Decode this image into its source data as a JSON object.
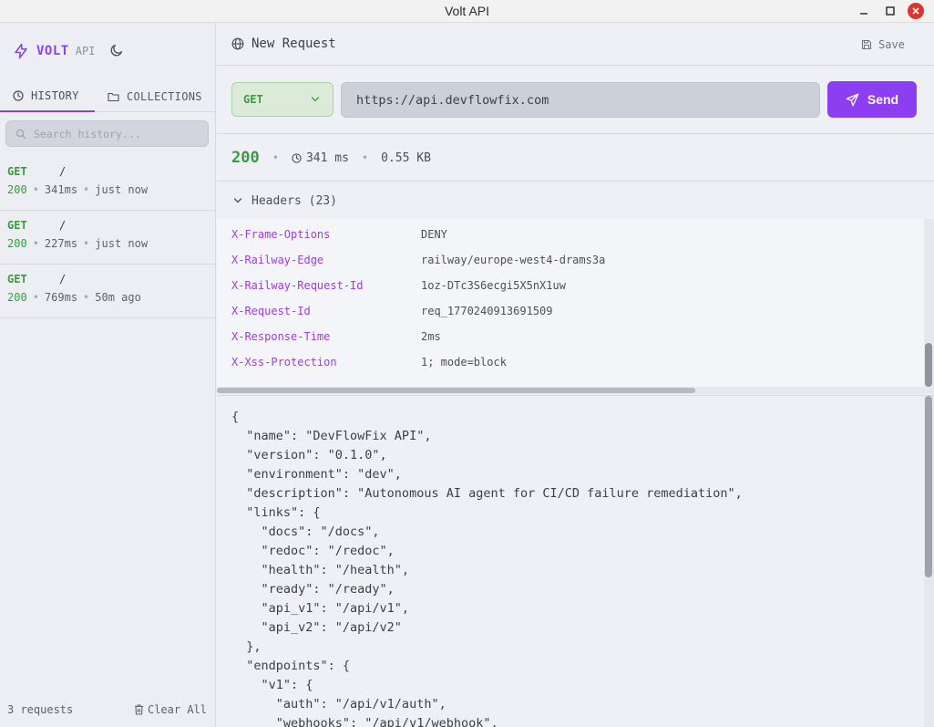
{
  "window": {
    "title": "Volt API"
  },
  "brand": {
    "name": "VOLT",
    "suffix": "API"
  },
  "sidebar": {
    "tabs": [
      {
        "label": "HISTORY",
        "icon": "clock-icon",
        "active": true
      },
      {
        "label": "COLLECTIONS",
        "icon": "folder-icon",
        "active": false
      }
    ],
    "search_placeholder": "Search history...",
    "history": [
      {
        "method": "GET",
        "path": "/",
        "status": "200",
        "time": "341ms",
        "age": "just now"
      },
      {
        "method": "GET",
        "path": "/",
        "status": "200",
        "time": "227ms",
        "age": "just now"
      },
      {
        "method": "GET",
        "path": "/",
        "status": "200",
        "time": "769ms",
        "age": "50m ago"
      }
    ],
    "footer_count": "3 requests",
    "clear_label": "Clear All"
  },
  "request": {
    "title": "New Request",
    "save_label": "Save",
    "method": "GET",
    "url": "https://api.devflowfix.com",
    "send_label": "Send"
  },
  "response": {
    "status": "200",
    "time": "341 ms",
    "size": "0.55 KB",
    "headers_label": "Headers (23)",
    "headers": [
      {
        "key": "X-Frame-Options",
        "value": "DENY"
      },
      {
        "key": "X-Railway-Edge",
        "value": "railway/europe-west4-drams3a"
      },
      {
        "key": "X-Railway-Request-Id",
        "value": "1oz-DTc3S6ecgi5X5nX1uw"
      },
      {
        "key": "X-Request-Id",
        "value": "req_1770240913691509"
      },
      {
        "key": "X-Response-Time",
        "value": "2ms"
      },
      {
        "key": "X-Xss-Protection",
        "value": "1; mode=block"
      }
    ],
    "body_lines": [
      "{",
      "  \"name\": \"DevFlowFix API\",",
      "  \"version\": \"0.1.0\",",
      "  \"environment\": \"dev\",",
      "  \"description\": \"Autonomous AI agent for CI/CD failure remediation\",",
      "  \"links\": {",
      "    \"docs\": \"/docs\",",
      "    \"redoc\": \"/redoc\",",
      "    \"health\": \"/health\",",
      "    \"ready\": \"/ready\",",
      "    \"api_v1\": \"/api/v1\",",
      "    \"api_v2\": \"/api/v2\"",
      "  },",
      "  \"endpoints\": {",
      "    \"v1\": {",
      "      \"auth\": \"/api/v1/auth\",",
      "      \"webhooks\": \"/api/v1/webhook\","
    ]
  },
  "colors": {
    "accent": "#8b3ff0",
    "success": "#3a9b3f",
    "header_key": "#9b3fd6"
  }
}
